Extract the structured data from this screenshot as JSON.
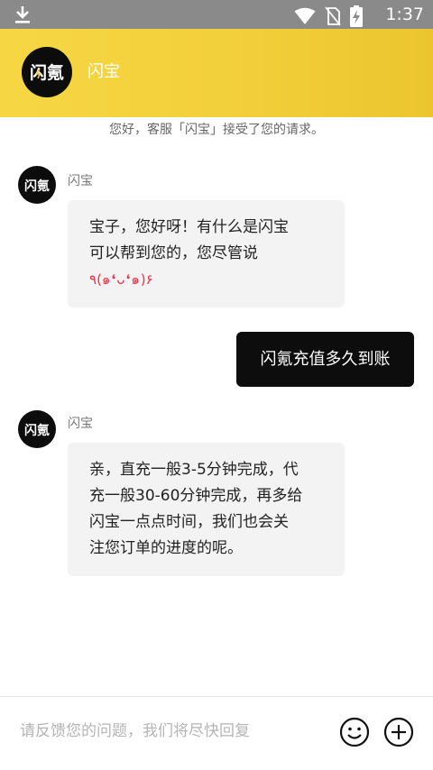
{
  "status_bar": {
    "time": "1:37",
    "icons": [
      "download-icon",
      "wifi-icon",
      "no-sim-icon",
      "battery-charging-icon"
    ]
  },
  "header": {
    "logo_text": "闪氪",
    "title": "闪宝",
    "colors": {
      "gradient_start": "#f6d743",
      "gradient_end": "#ecc52e"
    }
  },
  "system_note": "您好，客服「闪宝」接受了您的请求。",
  "messages": [
    {
      "direction": "in",
      "sender": "闪宝",
      "avatar_text": "闪氪",
      "lines": [
        "宝子，您好呀！有什么是闪宝",
        "可以帮到您的，您尽管说"
      ],
      "kaomoji": "٩(๑❛ᴗ❛๑)۶"
    },
    {
      "direction": "out",
      "text": "闪氪充值多久到账"
    },
    {
      "direction": "in",
      "sender": "闪宝",
      "avatar_text": "闪氪",
      "lines": [
        "亲，直充一般3-5分钟完成，代",
        "充一般30-60分钟完成，再多给",
        "闪宝一点点时间，我们也会关",
        "注您订单的进度的呢。"
      ]
    }
  ],
  "input_bar": {
    "placeholder": "请反馈您的问题，我们将尽快回复",
    "icons": [
      "emoji-icon",
      "plus-icon"
    ]
  }
}
